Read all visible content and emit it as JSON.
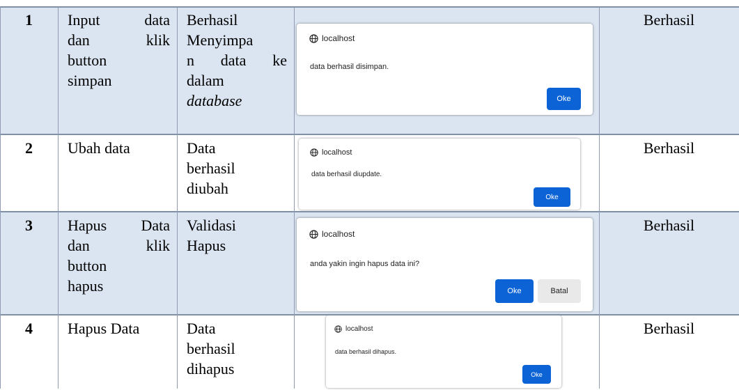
{
  "rows": [
    {
      "no": "1",
      "action_lines": [
        "Input data",
        "dan klik",
        "button",
        "simpan"
      ],
      "expected_lines": [
        "Berhasil",
        "Menyimpa",
        "n data ke",
        "dalam"
      ],
      "expected_italic": "database",
      "result": "Berhasil",
      "dialog": {
        "host": "localhost",
        "message": "data berhasil disimpan.",
        "ok_label": "Oke"
      }
    },
    {
      "no": "2",
      "action_lines": [
        "Ubah data"
      ],
      "expected_lines": [
        "Data",
        "berhasil",
        "diubah"
      ],
      "result": "Berhasil",
      "dialog": {
        "host": "localhost",
        "message": "data berhasil diupdate.",
        "ok_label": "Oke"
      }
    },
    {
      "no": "3",
      "action_lines": [
        "Hapus Data",
        "dan klik",
        "button",
        "hapus"
      ],
      "expected_lines": [
        "Validasi",
        "Hapus"
      ],
      "result": "Berhasil",
      "dialog": {
        "host": "localhost",
        "message": "anda yakin ingin hapus data ini?",
        "ok_label": "Oke",
        "cancel_label": "Batal"
      }
    },
    {
      "no": "4",
      "action_lines": [
        "Hapus Data"
      ],
      "expected_lines": [
        "Data",
        "berhasil",
        "dihapus"
      ],
      "result": "Berhasil",
      "dialog": {
        "host": "localhost",
        "message": "data berhasil dihapus.",
        "ok_label": "Oke"
      }
    }
  ],
  "colors": {
    "row_shade": "#dbe5f1",
    "primary_button": "#0b63d6",
    "secondary_button": "#e9e9ea"
  },
  "icons": {
    "dialog_host": "globe-icon"
  }
}
